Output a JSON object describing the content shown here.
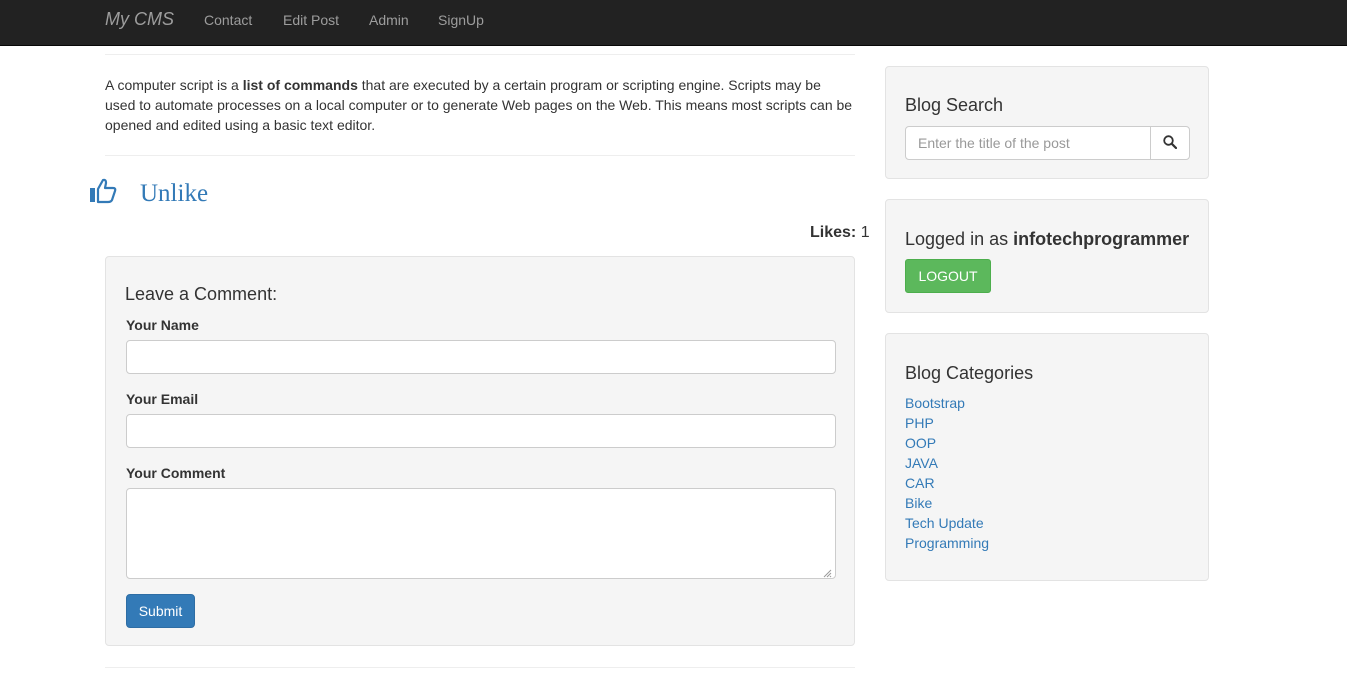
{
  "navbar": {
    "brand": "My CMS",
    "links": [
      "Contact",
      "Edit Post",
      "Admin",
      "SignUp"
    ]
  },
  "post": {
    "text_before": "A computer script is a ",
    "text_bold": "list of commands",
    "text_after": " that are executed by a certain program or scripting engine. Scripts may be used to automate processes on a local computer or to generate Web pages on the Web. This means most scripts can be opened and edited using a basic text editor."
  },
  "likes": {
    "icon": "thumbs-up-icon",
    "action_label": "Unlike",
    "count_label": "Likes:",
    "count": "1"
  },
  "comment_form": {
    "title": "Leave a Comment:",
    "name_label": "Your Name",
    "name_value": "",
    "email_label": "Your Email",
    "email_value": "",
    "comment_label": "Your Comment",
    "comment_value": "",
    "submit_label": "Submit"
  },
  "sidebar": {
    "search": {
      "title": "Blog Search",
      "placeholder": "Enter the title of the post",
      "value": "",
      "icon": "search-icon"
    },
    "user": {
      "prefix": "Logged in as ",
      "username": "infotechprogrammer",
      "logout_label": "LOGOUT"
    },
    "categories": {
      "title": "Blog Categories",
      "items": [
        "Bootstrap",
        "PHP",
        "OOP",
        "JAVA",
        "CAR",
        "Bike",
        "Tech Update",
        "Programming"
      ]
    }
  },
  "colors": {
    "navbar_bg": "#222222",
    "link": "#337ab7",
    "primary_button": "#337ab7",
    "success_button": "#5cb85c",
    "well_bg": "#f5f5f5"
  }
}
